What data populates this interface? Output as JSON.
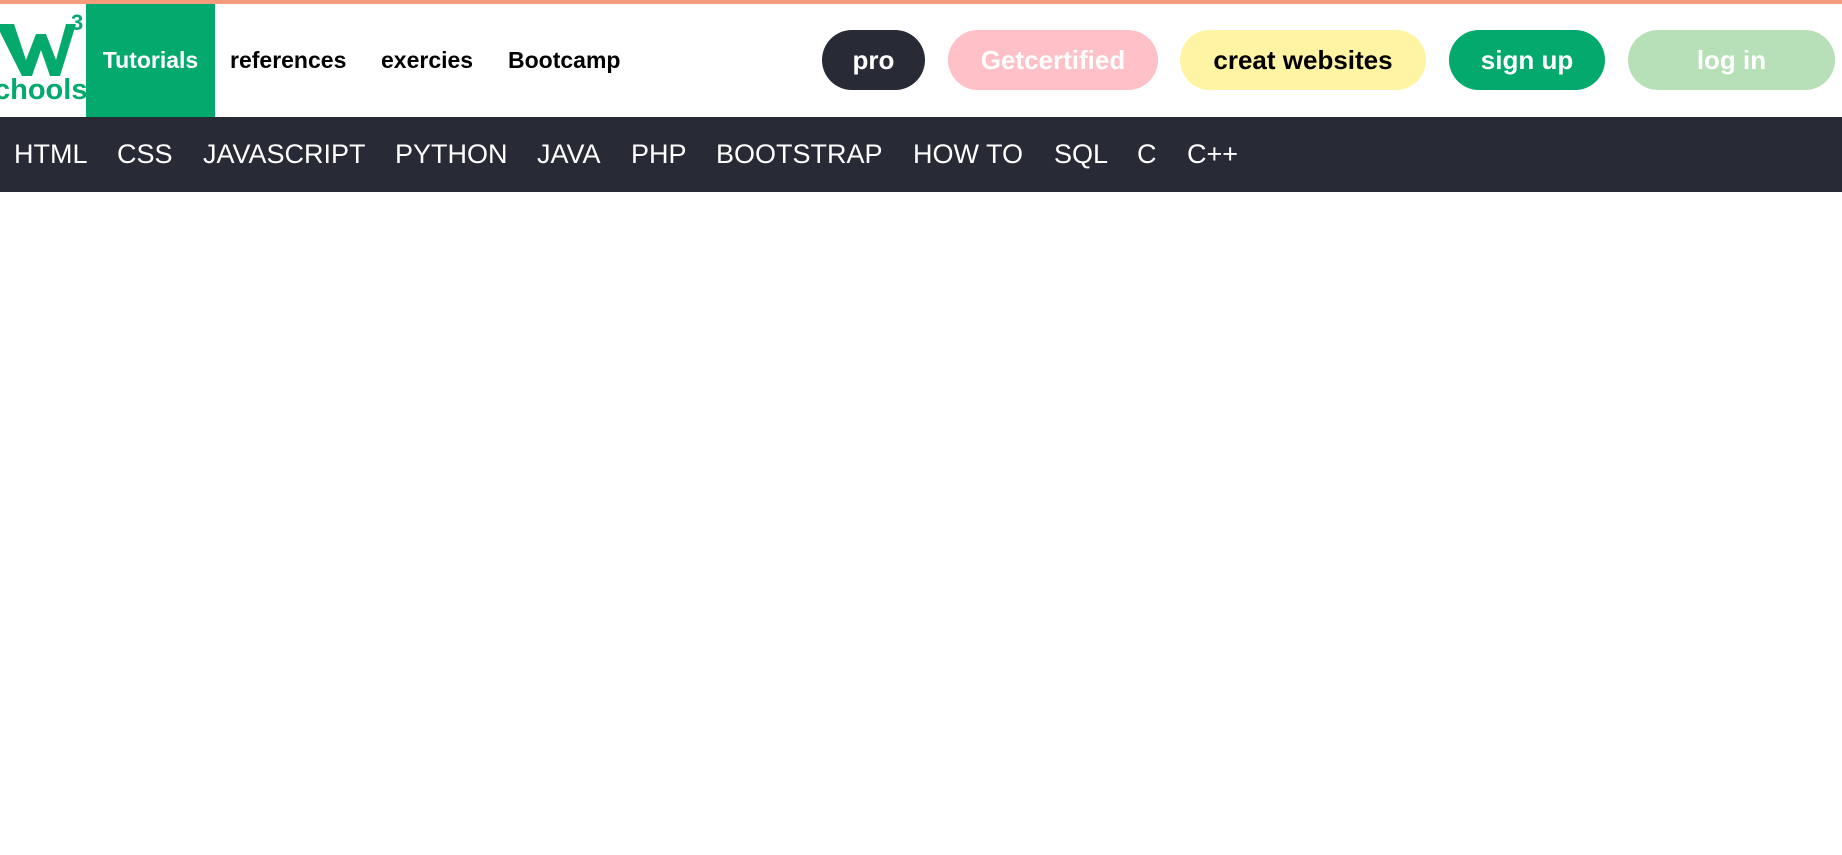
{
  "colors": {
    "brand_green": "#04aa6d",
    "dark": "#282a35",
    "accent_line": "#f79b7d"
  },
  "logo": {
    "text": "chools",
    "superscript": "3",
    "icon": "w3schools-logo"
  },
  "topnav": {
    "tutorials": "Tutorials",
    "references": "references",
    "exercises": "exercies",
    "bootcamp": "Bootcamp"
  },
  "actions": {
    "pro": "pro",
    "get_certified": "Getcertified",
    "create_websites": "creat websites",
    "sign_up": "sign up",
    "log_in": "log in"
  },
  "subnav": {
    "items": [
      "HTML",
      "CSS",
      "JAVASCRIPT",
      "PYTHON",
      "JAVA",
      "PHP",
      "BOOTSTRAP",
      "HOW TO",
      "SQL",
      "C",
      "C++"
    ]
  }
}
